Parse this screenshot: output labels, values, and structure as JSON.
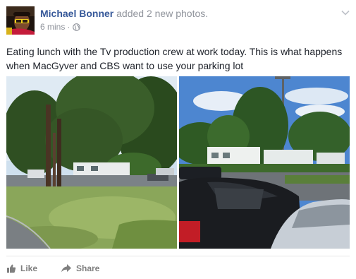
{
  "post": {
    "author": "Michael Bonner",
    "action": "added 2 new photos.",
    "timestamp": "6 mins",
    "separator": "·",
    "privacy_icon": "globe-icon",
    "options_icon": "chevron-down-icon",
    "text": "Eating lunch with the Tv production crew at work today. This is what happens when MacGyver and CBS want to use your parking lot",
    "photos": [
      {
        "name": "photo-pine-trees-lawn"
      },
      {
        "name": "photo-parking-lot-trailers"
      }
    ]
  },
  "actions": {
    "like_label": "Like",
    "share_label": "Share",
    "like_icon": "thumbs-up-icon",
    "share_icon": "share-arrow-icon"
  },
  "colors": {
    "author_link": "#365899",
    "meta_gray": "#90949c",
    "action_gray": "#7f7f7f",
    "body_text": "#1d2129"
  }
}
